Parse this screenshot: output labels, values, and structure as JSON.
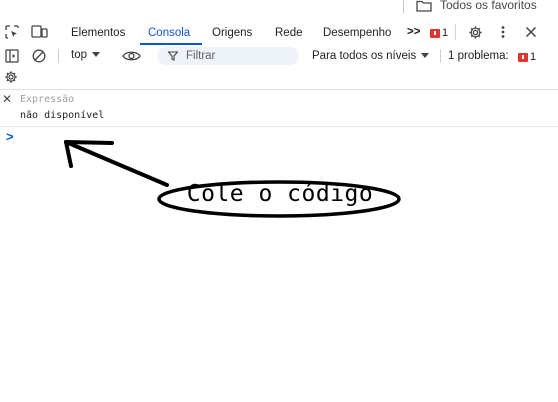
{
  "bookmarks": {
    "all_favorites": "Todos os favoritos"
  },
  "tabs": [
    {
      "label": "Elementos",
      "active": false
    },
    {
      "label": "Consola",
      "active": true
    },
    {
      "label": "Origens",
      "active": false
    },
    {
      "label": "Rede",
      "active": false
    },
    {
      "label": "Desempenho",
      "active": false
    }
  ],
  "tabbar": {
    "more_symbol": ">>",
    "issues_count": "1"
  },
  "console_toolbar": {
    "context": "top",
    "filter_placeholder": "Filtrar",
    "levels": "Para todos os níveis",
    "problems_label": "1 problema:",
    "problems_count": "1"
  },
  "live_expression": {
    "placeholder": "Expressão",
    "value": "não disponível"
  },
  "console": {
    "prompt_symbol": ">"
  },
  "annotation": {
    "text": "Cole o código"
  },
  "colors": {
    "accent": "#0b57d0",
    "error": "#dc362e"
  }
}
